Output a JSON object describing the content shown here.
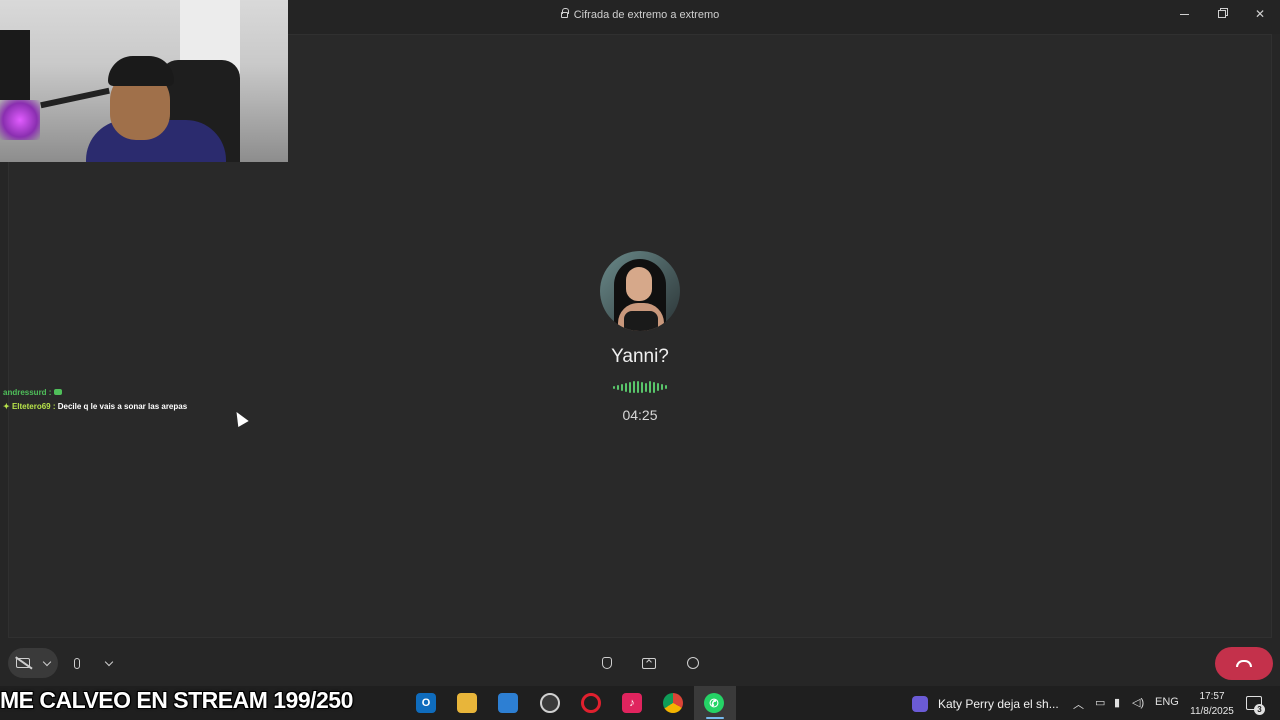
{
  "window": {
    "title": "Cifrada de extremo a extremo"
  },
  "chat": [
    {
      "user": "andressurd :",
      "message": ""
    },
    {
      "user": "Eltetero69 :",
      "message": "Decile q le vais a sonar las arepas"
    }
  ],
  "call": {
    "contact_name": "Yanni?",
    "duration": "04:25",
    "wave_color": "#59c66b",
    "end_call_color": "#c4314b"
  },
  "controls": {
    "camera_icon": "camera-off-icon",
    "mic_icon": "microphone-icon",
    "raise_hand_icon": "raise-hand-icon",
    "share_icon": "share-screen-icon",
    "add_people_icon": "add-people-icon",
    "end_call_icon": "end-call-icon"
  },
  "stream_banner": "ME CALVEO EN STREAM 199/250",
  "taskbar": {
    "apps": [
      "outlook",
      "file-explorer",
      "microsoft-store",
      "app-red",
      "opera",
      "tiktok",
      "chrome",
      "whatsapp"
    ],
    "media_title": "Katy Perry deja el sh...",
    "language": "ENG",
    "time": "17:57",
    "date": "11/8/2025",
    "notification_count": "3"
  }
}
